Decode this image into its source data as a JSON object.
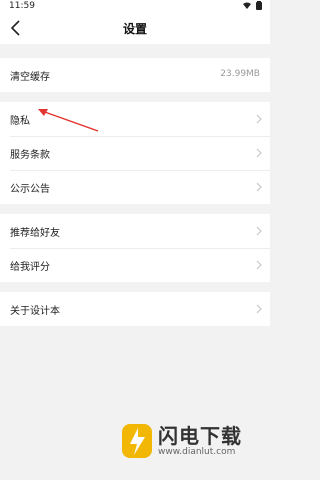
{
  "status": {
    "time": "11:59"
  },
  "header": {
    "title": "设置",
    "back_icon": "back-chevron-icon"
  },
  "groups": [
    {
      "items": [
        {
          "label": "清空缓存",
          "value": "23.99MB"
        }
      ]
    },
    {
      "items": [
        {
          "label": "隐私"
        },
        {
          "label": "服务条款"
        },
        {
          "label": "公示公告"
        }
      ]
    },
    {
      "items": [
        {
          "label": "推荐给好友"
        },
        {
          "label": "给我评分"
        }
      ]
    },
    {
      "items": [
        {
          "label": "关于设计本"
        }
      ]
    }
  ],
  "annotation": {
    "color": "#e3342f",
    "points_to": "隐私"
  },
  "watermark": {
    "title": "闪电下载",
    "url": "www.dianlut.com",
    "brand_color": "#f2b705"
  }
}
